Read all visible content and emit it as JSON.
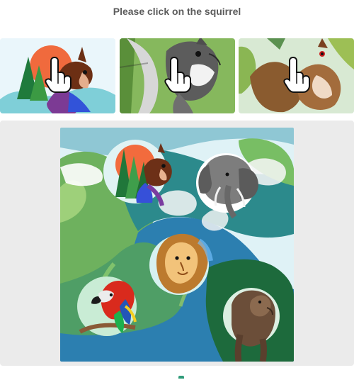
{
  "instruction": {
    "text": "Please click on the squirrel"
  },
  "examples": [
    {
      "label": "squirrel example 1"
    },
    {
      "label": "squirrel example 2"
    },
    {
      "label": "squirrel example 3"
    }
  ],
  "scene": {
    "objects": [
      {
        "name": "squirrel",
        "icon": "squirrel-in-forest"
      },
      {
        "name": "elephant",
        "icon": "elephant-sketch"
      },
      {
        "name": "lion",
        "icon": "lion-portrait"
      },
      {
        "name": "parrot",
        "icon": "macaw-on-branch"
      },
      {
        "name": "bear",
        "icon": "brown-bear"
      }
    ]
  },
  "colors": {
    "prompt": "#5c5c5c",
    "panel": "#ebebeb",
    "accent": "#2f9b79"
  }
}
